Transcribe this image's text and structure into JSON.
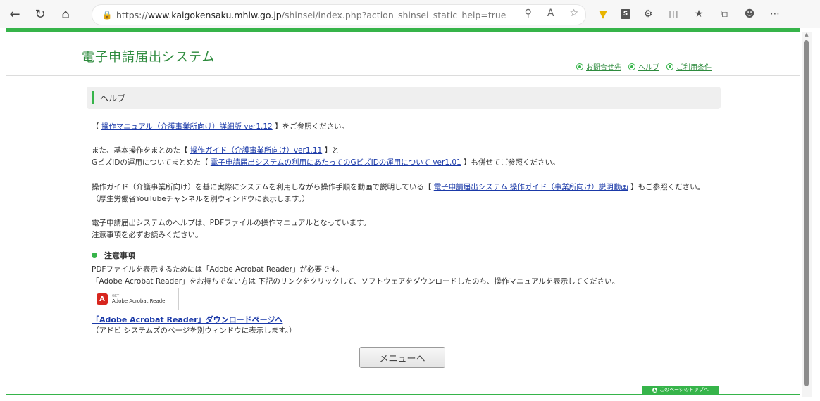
{
  "browser": {
    "url_prefix": "https://",
    "url_host": "www.kaigokensaku.mhlw.go.jp",
    "url_path": "/shinsei/index.php?action_shinsei_static_help=true"
  },
  "site": {
    "title": "電子申請届出システム",
    "links": [
      {
        "label": "お問合せ先"
      },
      {
        "label": "ヘルプ"
      },
      {
        "label": "ご利用条件"
      }
    ]
  },
  "help": {
    "heading": "ヘルプ",
    "p1_open": "【",
    "p1_link": "操作マニュアル（介護事業所向け）詳細版 ver1.12",
    "p1_close": "】をご参照ください。",
    "p2_l1_pre": "また、基本操作をまとめた【",
    "p2_l1_link": "操作ガイド（介護事業所向け）ver1.11",
    "p2_l1_post": "】と",
    "p2_l2_pre": "GビズIDの運用についてまとめた【",
    "p2_l2_link": "電子申請届出システムの利用にあたってのGビズIDの運用について ver1.01",
    "p2_l2_post": "】も併せてご参照ください。",
    "p3_l1_pre": "操作ガイド（介護事業所向け）を基に実際にシステムを利用しながら操作手順を動画で説明している【",
    "p3_l1_link": "電子申請届出システム 操作ガイド（事業所向け）説明動画",
    "p3_l1_post": "】もご参照ください。",
    "p3_l2": "（厚生労働省YouTubeチャンネルを別ウィンドウに表示します。）",
    "p4_l1": "電子申請届出システムのヘルプは、PDFファイルの操作マニュアルとなっています。",
    "p4_l2": "注意事項を必ずお読みください。"
  },
  "notice": {
    "heading": "注意事項",
    "l1": "PDFファイルを表示するためには「Adobe Acrobat Reader」が必要です。",
    "l2": "「Adobe Acrobat Reader」をお持ちでない方は 下記のリンクをクリックして、ソフトウェアをダウンロードしたのち、操作マニュアルを表示してください。",
    "badge_small": "GET",
    "badge_name": "Adobe Acrobat Reader",
    "download_link": "「Adobe Acrobat Reader」ダウンロードページへ",
    "download_note": "（アドビ システムズのページを別ウィンドウに表示します。）"
  },
  "menu_button": "メニューへ",
  "pagetop": "このページのトップへ",
  "colors": {
    "accent_green": "#36b44a",
    "link_blue": "#1a39a8"
  }
}
